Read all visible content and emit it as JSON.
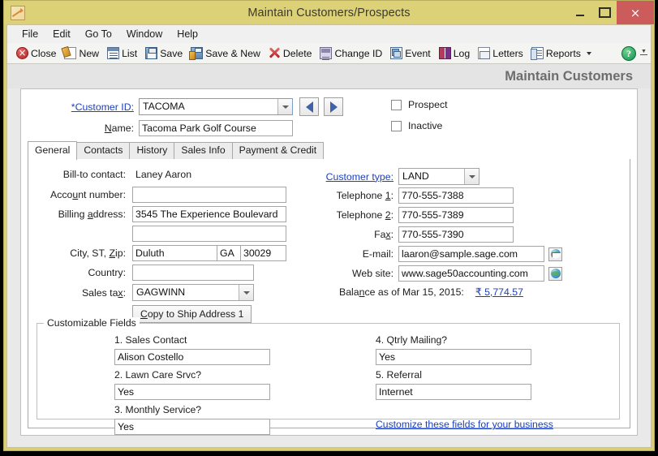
{
  "window": {
    "title": "Maintain Customers/Prospects",
    "app_icon": "chart-growth-icon",
    "controls": {
      "minimize": "minimize-icon",
      "maximize": "maximize-icon",
      "close": "×"
    },
    "accent_titlebar": "#ddd178",
    "accent_close": "#cc5b5b"
  },
  "menubar": {
    "items": [
      "File",
      "Edit",
      "Go To",
      "Window",
      "Help"
    ]
  },
  "toolbar": {
    "buttons": [
      {
        "label": "Close",
        "icon": "close-circle-icon",
        "mnemonic": ""
      },
      {
        "label": "New",
        "icon": "new-document-icon",
        "mnemonic": ""
      },
      {
        "label": "List",
        "icon": "list-grid-icon",
        "mnemonic": "i"
      },
      {
        "label": "Save",
        "icon": "save-disk-icon",
        "mnemonic": "S"
      },
      {
        "label": "Save & New",
        "icon": "save-and-new-icon",
        "mnemonic": ""
      },
      {
        "label": "Delete",
        "icon": "delete-x-icon",
        "mnemonic": ""
      },
      {
        "label": "Change ID",
        "icon": "change-id-icon",
        "mnemonic": ""
      },
      {
        "label": "Event",
        "icon": "event-icon",
        "mnemonic": "v"
      },
      {
        "label": "Log",
        "icon": "log-book-icon",
        "mnemonic": "L"
      },
      {
        "label": "Letters",
        "icon": "letters-icon",
        "mnemonic": ""
      },
      {
        "label": "Reports",
        "icon": "reports-icon",
        "mnemonic": "",
        "has_caret": true
      }
    ],
    "help_glyph": "?",
    "help_icon": "help-question-icon",
    "overflow_icon": "toolbar-overflow-icon"
  },
  "page": {
    "heading": "Maintain Customers"
  },
  "header_form": {
    "customer_id_label": "*Customer ID:",
    "customer_id_value": "TACOMA",
    "name_label": "Name:",
    "name_value": "Tacoma Park Golf Course",
    "prev_icon": "previous-record-icon",
    "next_icon": "next-record-icon",
    "prospect_label": "Prospect",
    "prospect_checked": false,
    "inactive_label": "Inactive",
    "inactive_checked": false
  },
  "tabs": [
    {
      "label": "General",
      "active": true
    },
    {
      "label": "Contacts",
      "active": false
    },
    {
      "label": "History",
      "active": false
    },
    {
      "label": "Sales Info",
      "active": false
    },
    {
      "label": "Payment & Credit",
      "active": false
    }
  ],
  "general": {
    "left": {
      "bill_to_contact_label": "Bill-to contact:",
      "bill_to_contact_value": "Laney Aaron",
      "account_number_label": "Account number:",
      "account_number_value": "",
      "billing_address_label": "Billing address:",
      "billing_address_line1": "3545 The Experience Boulevard",
      "billing_address_line2": "",
      "city_st_zip_label": "City, ST, Zip:",
      "city_value": "Duluth",
      "state_value": "GA",
      "zip_value": "30029",
      "country_label": "Country:",
      "country_value": "",
      "sales_tax_label": "Sales tax:",
      "sales_tax_value": "GAGWINN",
      "copy_ship_button": "Copy to Ship Address 1"
    },
    "right": {
      "customer_type_label": "Customer type:",
      "customer_type_value": "LAND",
      "telephone1_label": "Telephone 1:",
      "telephone1_value": "770-555-7388",
      "telephone2_label": "Telephone 2:",
      "telephone2_value": "770-555-7389",
      "fax_label": "Fax:",
      "fax_value": "770-555-7390",
      "email_label": "E-mail:",
      "email_value": "laaron@sample.sage.com",
      "email_button_icon": "email-globe-icon",
      "website_label": "Web site:",
      "website_value": "www.sage50accounting.com",
      "website_button_icon": "web-globe-icon",
      "balance_label": "Balance as of Mar 15, 2015:",
      "balance_value": "₹ 5,774.57"
    }
  },
  "customizable_fields": {
    "legend": "Customizable Fields",
    "fields": [
      {
        "label": "1. Sales Contact",
        "value": "Alison Costello"
      },
      {
        "label": "2. Lawn Care Srvc?",
        "value": "Yes"
      },
      {
        "label": "3. Monthly Service?",
        "value": "Yes"
      },
      {
        "label": "4. Qtrly Mailing?",
        "value": "Yes"
      },
      {
        "label": "5. Referral",
        "value": "Internet"
      }
    ],
    "customize_link": "Customize these fields for your business"
  }
}
